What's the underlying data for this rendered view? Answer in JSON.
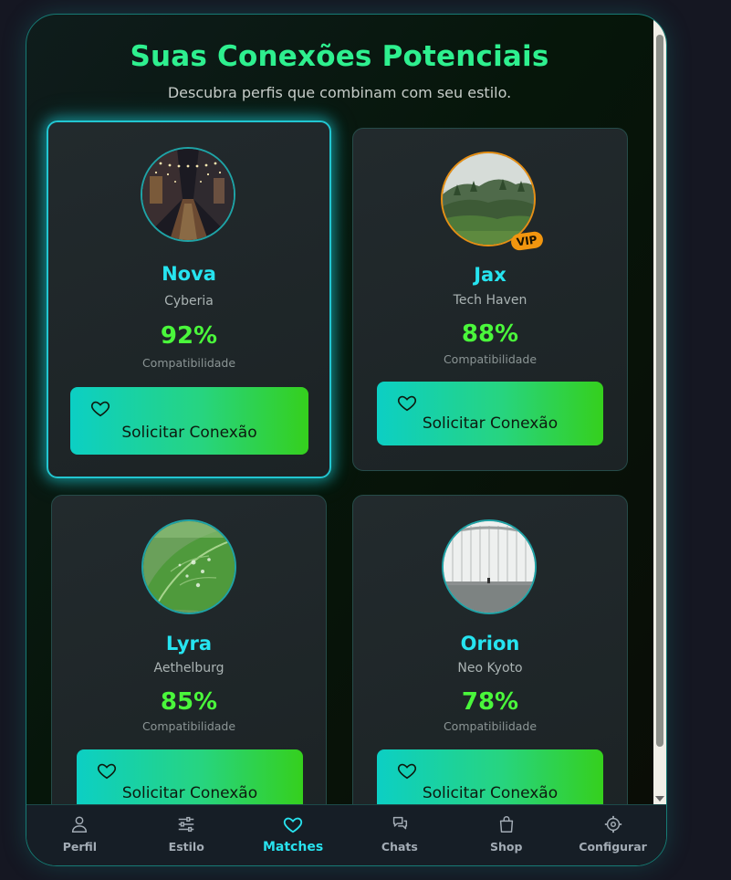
{
  "header": {
    "title": "Suas Conexões Potenciais",
    "subtitle": "Descubra perfis que combinam com seu estilo."
  },
  "matches": [
    {
      "name": "Nova",
      "location": "Cyberia",
      "compatibility": "92%",
      "compatibility_label": "Compatibilidade",
      "button_label": "Solicitar Conexão",
      "vip": false,
      "photo": "night-alley-lights"
    },
    {
      "name": "Jax",
      "location": "Tech Haven",
      "compatibility": "88%",
      "compatibility_label": "Compatibilidade",
      "button_label": "Solicitar Conexão",
      "vip": true,
      "vip_label": "VIP",
      "photo": "misty-forest-hill"
    },
    {
      "name": "Lyra",
      "location": "Aethelburg",
      "compatibility": "85%",
      "compatibility_label": "Compatibilidade",
      "button_label": "Solicitar Conexão",
      "vip": false,
      "photo": "leaf-water-drops"
    },
    {
      "name": "Orion",
      "location": "Neo Kyoto",
      "compatibility": "78%",
      "compatibility_label": "Compatibilidade",
      "button_label": "Solicitar Conexão",
      "vip": false,
      "photo": "railing-sea-view"
    }
  ],
  "nav": {
    "items": [
      {
        "label": "Perfil",
        "icon": "user-icon"
      },
      {
        "label": "Estilo",
        "icon": "sliders-icon"
      },
      {
        "label": "Matches",
        "icon": "heart-icon",
        "active": true
      },
      {
        "label": "Chats",
        "icon": "chat-icon"
      },
      {
        "label": "Shop",
        "icon": "shopping-bag-icon"
      },
      {
        "label": "Configurar",
        "icon": "settings-icon"
      }
    ]
  },
  "colors": {
    "title": "#2ef08f",
    "name": "#26e4f0",
    "score": "#4af73b",
    "accent": "#22c6d1",
    "vip": "#f2960f"
  }
}
